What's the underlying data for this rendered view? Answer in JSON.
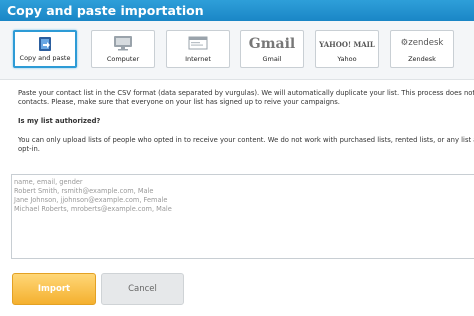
{
  "window": {
    "title": "Copy and paste importation"
  },
  "sources": [
    {
      "label": "Copy and paste",
      "icon": "clipboard-arrow-icon",
      "selected": true
    },
    {
      "label": "Computer",
      "icon": "monitor-icon"
    },
    {
      "label": "Internet",
      "icon": "browser-window-icon"
    },
    {
      "label": "Gmail",
      "icon": "gmail-logo",
      "logo_text": "Gmail"
    },
    {
      "label": "Yahoo",
      "icon": "yahoo-logo",
      "logo_text": "YAHOO! MAIL"
    },
    {
      "label": "Zendesk",
      "icon": "zendesk-logo",
      "logo_text": "zendesk"
    }
  ],
  "instructions": {
    "line1": "Paste your contact list in the CSV format (data separated by vurgulas). We will automatically duplicate your list. This process does not send",
    "line2": "contacts. Please, make sure that everyone on your list has signed up to reive your campaigns.",
    "question": "Is my list authorized?",
    "answer1": "You can only upload lists of people who opted in to receive your content. We do not work with purchased lists, rented lists, or any list acqui",
    "answer2": "opt-in."
  },
  "paste_area": {
    "lines": [
      "name, email, gender",
      "Robert Smith, rsmith@example.com, Male",
      "Jane Johnson, jjohnson@example.com, Female",
      "Michael Roberts, mroberts@example.com, Male"
    ]
  },
  "actions": {
    "import_label": "Import",
    "cancel_label": "Cancel"
  },
  "colors": {
    "titlebar": "#1f8fcf",
    "accent": "#2d9bd6",
    "import": "#f4b02f"
  }
}
